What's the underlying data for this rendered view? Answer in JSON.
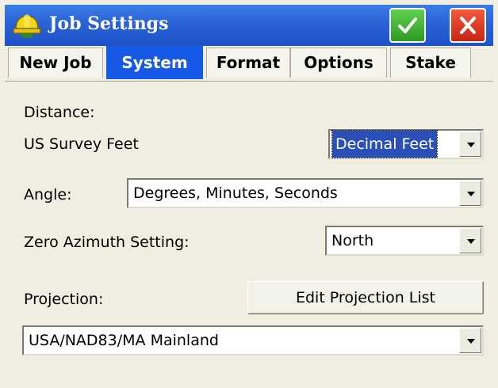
{
  "window": {
    "title": "Job Settings",
    "icon": "hardhat-icon",
    "ok_icon": "checkmark-icon",
    "close_icon": "close-x-icon"
  },
  "tabs": [
    {
      "label": "New Job"
    },
    {
      "label": "System"
    },
    {
      "label": "Format"
    },
    {
      "label": "Options"
    },
    {
      "label": "Stake"
    }
  ],
  "active_tab": "System",
  "distance": {
    "label": "Distance:",
    "units": "US Survey Feet",
    "format_value": "Decimal Feet"
  },
  "angle": {
    "label": "Angle:",
    "value": "Degrees, Minutes, Seconds"
  },
  "zero_azimuth": {
    "label": "Zero Azimuth Setting:",
    "value": "North"
  },
  "projection": {
    "label": "Projection:",
    "edit_button": "Edit Projection List",
    "value": "USA/NAD83/MA Mainland"
  },
  "colors": {
    "titlebar": "#2a62d6",
    "active_tab": "#1659e6",
    "ok_green": "#3fb22f",
    "close_red": "#d93a22",
    "panel": "#efeee1"
  }
}
